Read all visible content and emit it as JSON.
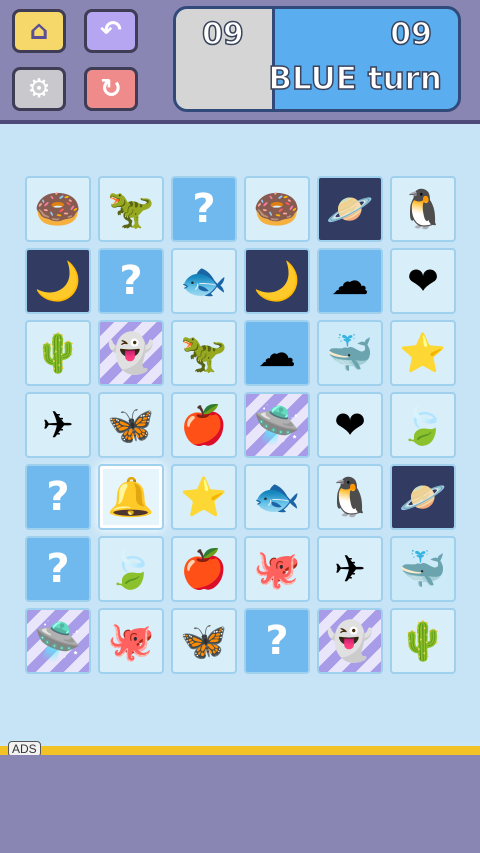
{
  "toolbar": {
    "home_icon": "home-icon",
    "undo_icon": "undo-icon",
    "settings_icon": "gear-icon",
    "restart_icon": "restart-icon"
  },
  "scoreboard": {
    "player1_score": "09",
    "player2_score": "09",
    "turn_label": "BLUE turn"
  },
  "board": {
    "tiles": [
      {
        "icon": "donut-icon",
        "glyph": "🍩",
        "bg": "bg-light"
      },
      {
        "icon": "dinosaur-icon",
        "glyph": "🦖",
        "bg": "bg-light"
      },
      {
        "icon": "question-icon",
        "glyph": "?",
        "bg": "bg-blue"
      },
      {
        "icon": "donut-icon",
        "glyph": "🍩",
        "bg": "bg-light"
      },
      {
        "icon": "planet-icon",
        "glyph": "🪐",
        "bg": "bg-dark"
      },
      {
        "icon": "penguin-icon",
        "glyph": "🐧",
        "bg": "bg-light"
      },
      {
        "icon": "moon-icon",
        "glyph": "🌙",
        "bg": "bg-dark"
      },
      {
        "icon": "question-icon",
        "glyph": "?",
        "bg": "bg-blue"
      },
      {
        "icon": "fish-icon",
        "glyph": "🐟",
        "bg": "bg-light"
      },
      {
        "icon": "moon-icon",
        "glyph": "🌙",
        "bg": "bg-dark"
      },
      {
        "icon": "cloud-icon",
        "glyph": "☁",
        "bg": "bg-blue"
      },
      {
        "icon": "heart-icon",
        "glyph": "❤",
        "bg": "bg-light"
      },
      {
        "icon": "cactus-icon",
        "glyph": "🌵",
        "bg": "bg-light"
      },
      {
        "icon": "ghost-icon",
        "glyph": "👻",
        "bg": "bg-stripe"
      },
      {
        "icon": "dinosaur-icon",
        "glyph": "🦖",
        "bg": "bg-light"
      },
      {
        "icon": "cloud-icon",
        "glyph": "☁",
        "bg": "bg-blue"
      },
      {
        "icon": "whale-icon",
        "glyph": "🐳",
        "bg": "bg-cyan"
      },
      {
        "icon": "star-icon",
        "glyph": "⭐",
        "bg": "bg-light"
      },
      {
        "icon": "airplane-icon",
        "glyph": "✈",
        "bg": "bg-light"
      },
      {
        "icon": "butterfly-icon",
        "glyph": "🦋",
        "bg": "bg-light"
      },
      {
        "icon": "apple-icon",
        "glyph": "🍎",
        "bg": "bg-light"
      },
      {
        "icon": "ufo-icon",
        "glyph": "🛸",
        "bg": "bg-stripe"
      },
      {
        "icon": "heart-icon",
        "glyph": "❤",
        "bg": "bg-light"
      },
      {
        "icon": "leaf-icon",
        "glyph": "🍃",
        "bg": "bg-light"
      },
      {
        "icon": "question-icon",
        "glyph": "?",
        "bg": "bg-blue"
      },
      {
        "icon": "bell-icon",
        "glyph": "🔔",
        "bg": "bg-light",
        "selected": true
      },
      {
        "icon": "star-icon",
        "glyph": "⭐",
        "bg": "bg-light"
      },
      {
        "icon": "fish-icon",
        "glyph": "🐟",
        "bg": "bg-light"
      },
      {
        "icon": "penguin-icon",
        "glyph": "🐧",
        "bg": "bg-light"
      },
      {
        "icon": "planet-icon",
        "glyph": "🪐",
        "bg": "bg-dark"
      },
      {
        "icon": "question-icon",
        "glyph": "?",
        "bg": "bg-blue"
      },
      {
        "icon": "leaf-icon",
        "glyph": "🍃",
        "bg": "bg-light"
      },
      {
        "icon": "apple-icon",
        "glyph": "🍎",
        "bg": "bg-light"
      },
      {
        "icon": "octopus-icon",
        "glyph": "🐙",
        "bg": "bg-light"
      },
      {
        "icon": "airplane-icon",
        "glyph": "✈",
        "bg": "bg-light"
      },
      {
        "icon": "whale-icon",
        "glyph": "🐳",
        "bg": "bg-cyan"
      },
      {
        "icon": "ufo-icon",
        "glyph": "🛸",
        "bg": "bg-stripe"
      },
      {
        "icon": "octopus-icon",
        "glyph": "🐙",
        "bg": "bg-light"
      },
      {
        "icon": "butterfly-icon",
        "glyph": "🦋",
        "bg": "bg-light"
      },
      {
        "icon": "question-icon",
        "glyph": "?",
        "bg": "bg-blue"
      },
      {
        "icon": "ghost-icon",
        "glyph": "👻",
        "bg": "bg-stripe"
      },
      {
        "icon": "cactus-icon",
        "glyph": "🌵",
        "bg": "bg-light"
      }
    ]
  },
  "ads_label": "ADS",
  "colors": {
    "toolbar_bg": "#8a86b4",
    "board_bg": "#c7e4f6",
    "score_blue": "#5aaef0",
    "accent_yellow": "#f3c326"
  }
}
